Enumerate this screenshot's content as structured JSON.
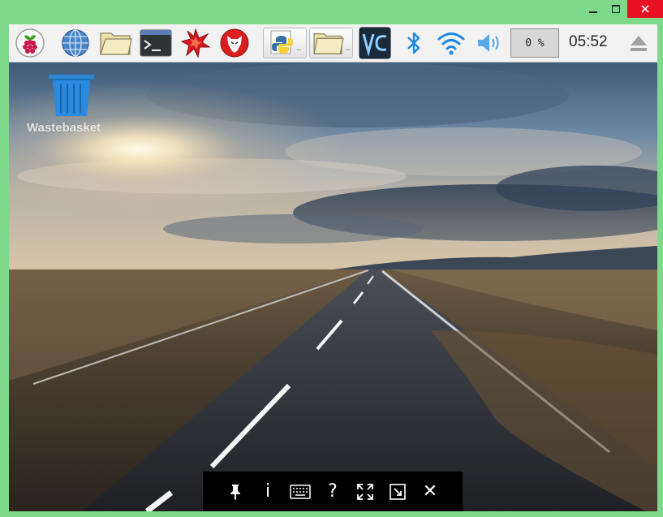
{
  "host_window": {
    "controls": {
      "minimize_icon": "minimize-icon",
      "maximize_icon": "maximize-icon",
      "close_icon": "close-icon"
    }
  },
  "panel": {
    "launchers": [
      {
        "name": "raspberry-menu",
        "icon": "raspberry-pi-icon"
      },
      {
        "name": "web-browser",
        "icon": "globe-icon"
      },
      {
        "name": "file-manager",
        "icon": "folder-icon"
      },
      {
        "name": "terminal",
        "icon": "terminal-icon"
      },
      {
        "name": "mathematica",
        "icon": "mathematica-icon"
      },
      {
        "name": "wolfram",
        "icon": "wolfram-icon"
      }
    ],
    "tasks": [
      {
        "name": "python-window",
        "icon": "python-icon",
        "suffix": ".."
      },
      {
        "name": "folder-window",
        "icon": "folder-icon",
        "suffix": ".."
      }
    ],
    "tray": {
      "vnc_icon": "vnc-icon",
      "bluetooth_icon": "bluetooth-icon",
      "wifi_icon": "wifi-icon",
      "volume_icon": "volume-icon",
      "cpu_usage": "0 %",
      "clock": "05:52",
      "eject_icon": "eject-icon"
    }
  },
  "desktop": {
    "trash_label": "Wastebasket"
  },
  "vnc_toolbar": {
    "info_glyph": "i",
    "help_glyph": "?",
    "close_glyph": "✕"
  },
  "colors": {
    "host_frame": "#7ed98a",
    "close_button": "#e81123",
    "tray_blue": "#1e88e5",
    "toolbar_bg": "#000000"
  }
}
